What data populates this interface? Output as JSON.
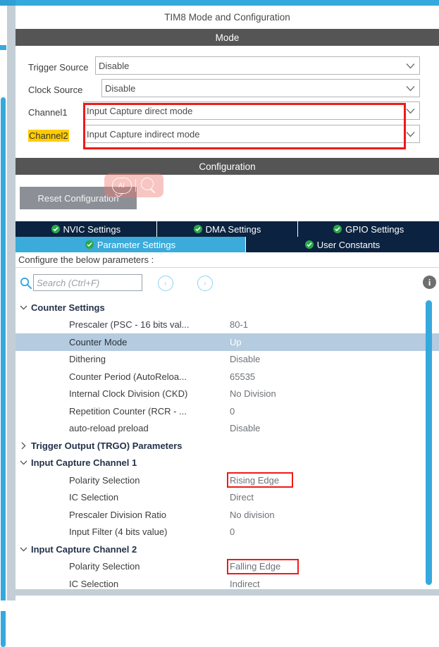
{
  "window": {
    "title": "TIM8 Mode and Configuration"
  },
  "mode_section": {
    "header": "Mode",
    "rows": [
      {
        "label": "Trigger Source",
        "value": "Disable",
        "highlighted_label": false,
        "boxed": false
      },
      {
        "label": "Clock Source",
        "value": "Disable",
        "highlighted_label": false,
        "boxed": false
      },
      {
        "label": "Channel1",
        "value": "Input Capture direct mode",
        "highlighted_label": false,
        "boxed": true
      },
      {
        "label": "Channel2",
        "value": "Input Capture indirect mode",
        "highlighted_label": true,
        "boxed": true
      }
    ]
  },
  "configuration_section": {
    "header": "Configuration",
    "reset_button": "Reset Configuration",
    "watermark": {
      "ai_label": "AI",
      "search_icon": "magnifier-icon"
    },
    "tabs_row1": [
      {
        "label": "NVIC Settings",
        "active": false
      },
      {
        "label": "DMA Settings",
        "active": false
      },
      {
        "label": "GPIO Settings",
        "active": false
      }
    ],
    "tabs_row2": [
      {
        "label": "Parameter Settings",
        "active": true
      },
      {
        "label": "User Constants",
        "active": false
      }
    ],
    "configure_note": "Configure the below parameters :",
    "search": {
      "placeholder": "Search (Ctrl+F)",
      "value": "",
      "icon": "search-icon",
      "prev_label": "‹",
      "next_label": "›",
      "info_label": "i"
    }
  },
  "parameters": [
    {
      "kind": "group",
      "label": "Counter Settings",
      "expanded": true
    },
    {
      "kind": "param",
      "name": "Prescaler (PSC - 16 bits val...",
      "value": "80-1",
      "selected": false,
      "boxed": false
    },
    {
      "kind": "param",
      "name": "Counter Mode",
      "value": "Up",
      "selected": true,
      "boxed": false
    },
    {
      "kind": "param",
      "name": "Dithering",
      "value": "Disable",
      "selected": false,
      "boxed": false
    },
    {
      "kind": "param",
      "name": "Counter Period (AutoReloa...",
      "value": "65535",
      "selected": false,
      "boxed": false
    },
    {
      "kind": "param",
      "name": "Internal Clock Division (CKD)",
      "value": "No Division",
      "selected": false,
      "boxed": false
    },
    {
      "kind": "param",
      "name": "Repetition Counter (RCR - ...",
      "value": "0",
      "selected": false,
      "boxed": false
    },
    {
      "kind": "param",
      "name": "auto-reload preload",
      "value": "Disable",
      "selected": false,
      "boxed": false
    },
    {
      "kind": "group",
      "label": "Trigger Output (TRGO) Parameters",
      "expanded": false
    },
    {
      "kind": "group",
      "label": "Input Capture Channel 1",
      "expanded": true
    },
    {
      "kind": "param",
      "name": "Polarity Selection",
      "value": "Rising Edge",
      "selected": false,
      "boxed": true
    },
    {
      "kind": "param",
      "name": "IC Selection",
      "value": "Direct",
      "selected": false,
      "boxed": false
    },
    {
      "kind": "param",
      "name": "Prescaler Division Ratio",
      "value": "No division",
      "selected": false,
      "boxed": false
    },
    {
      "kind": "param",
      "name": "Input Filter (4 bits value)",
      "value": "0",
      "selected": false,
      "boxed": false
    },
    {
      "kind": "group",
      "label": "Input Capture Channel 2",
      "expanded": true
    },
    {
      "kind": "param",
      "name": "Polarity Selection",
      "value": "Falling Edge",
      "selected": false,
      "boxed": true
    },
    {
      "kind": "param",
      "name": "IC Selection",
      "value": "Indirect",
      "selected": false,
      "boxed": false
    }
  ],
  "colors": {
    "accent_blue": "#35a9dd",
    "tab_active": "#3aabdb",
    "tab_inactive": "#0b2240",
    "section_header": "#555555",
    "highlight_red": "#ee1b17",
    "highlight_yellow": "#ffcc00",
    "row_selected": "#b4cbe0",
    "ok_green": "#2aa84a"
  }
}
